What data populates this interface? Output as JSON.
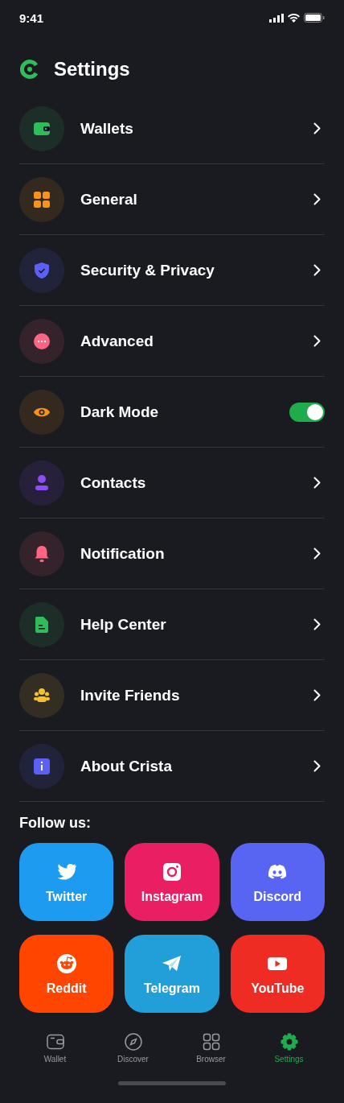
{
  "status_bar": {
    "time": "9:41"
  },
  "header": {
    "title": "Settings"
  },
  "items": [
    {
      "label": "Wallets",
      "kind": "link",
      "color": "#2ebd59"
    },
    {
      "label": "General",
      "kind": "link",
      "color": "#f7931a"
    },
    {
      "label": "Security & Privacy",
      "kind": "link",
      "color": "#5b61f6"
    },
    {
      "label": "Advanced",
      "kind": "link",
      "color": "#ff6482"
    },
    {
      "label": "Dark Mode",
      "kind": "toggle",
      "on": true,
      "color": "#f7931a"
    },
    {
      "label": "Contacts",
      "kind": "link",
      "color": "#8e4df6"
    },
    {
      "label": "Notification",
      "kind": "link",
      "color": "#ff6482"
    },
    {
      "label": "Help Center",
      "kind": "link",
      "color": "#2ebd59"
    },
    {
      "label": "Invite Friends",
      "kind": "link",
      "color": "#f5c12e"
    },
    {
      "label": "About Crista",
      "kind": "link",
      "color": "#5b61f6"
    }
  ],
  "follow": {
    "title": "Follow us:",
    "links": [
      {
        "label": "Twitter",
        "color": "#1d9bf0"
      },
      {
        "label": "Instagram",
        "color": "#e91e63"
      },
      {
        "label": "Discord",
        "color": "#5865f2"
      },
      {
        "label": "Reddit",
        "color": "#ff4500"
      },
      {
        "label": "Telegram",
        "color": "#229ed9"
      },
      {
        "label": "YouTube",
        "color": "#ee2c24"
      }
    ]
  },
  "tab_bar": [
    {
      "label": "Wallet",
      "selected": false
    },
    {
      "label": "Discover",
      "selected": false
    },
    {
      "label": "Browser",
      "selected": false
    },
    {
      "label": "Settings",
      "selected": true
    }
  ]
}
